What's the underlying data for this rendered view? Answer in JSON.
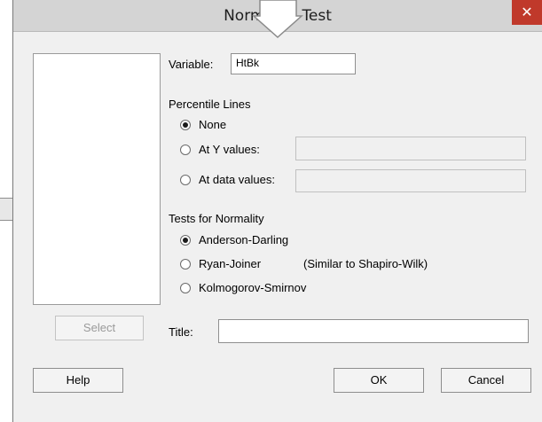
{
  "window": {
    "title": "Normality Test",
    "close_glyph": "✕"
  },
  "variable": {
    "label": "Variable:",
    "value": "HtBk"
  },
  "percentile_lines": {
    "heading": "Percentile Lines",
    "options": [
      {
        "label": "None",
        "checked": true
      },
      {
        "label": "At Y values:",
        "checked": false,
        "field_value": ""
      },
      {
        "label": "At data values:",
        "checked": false,
        "field_value": ""
      }
    ]
  },
  "tests": {
    "heading": "Tests for Normality",
    "options": [
      {
        "label": "Anderson-Darling",
        "checked": true
      },
      {
        "label": "Ryan-Joiner",
        "checked": false,
        "note": "(Similar to Shapiro-Wilk)"
      },
      {
        "label": "Kolmogorov-Smirnov",
        "checked": false
      }
    ]
  },
  "title_field": {
    "label": "Title:",
    "value": ""
  },
  "buttons": {
    "select": "Select",
    "help": "Help",
    "ok": "OK",
    "cancel": "Cancel"
  },
  "colors": {
    "close": "#c0392b",
    "titlebar": "#d4d4d4",
    "dialog_bg": "#f0f0f0"
  }
}
